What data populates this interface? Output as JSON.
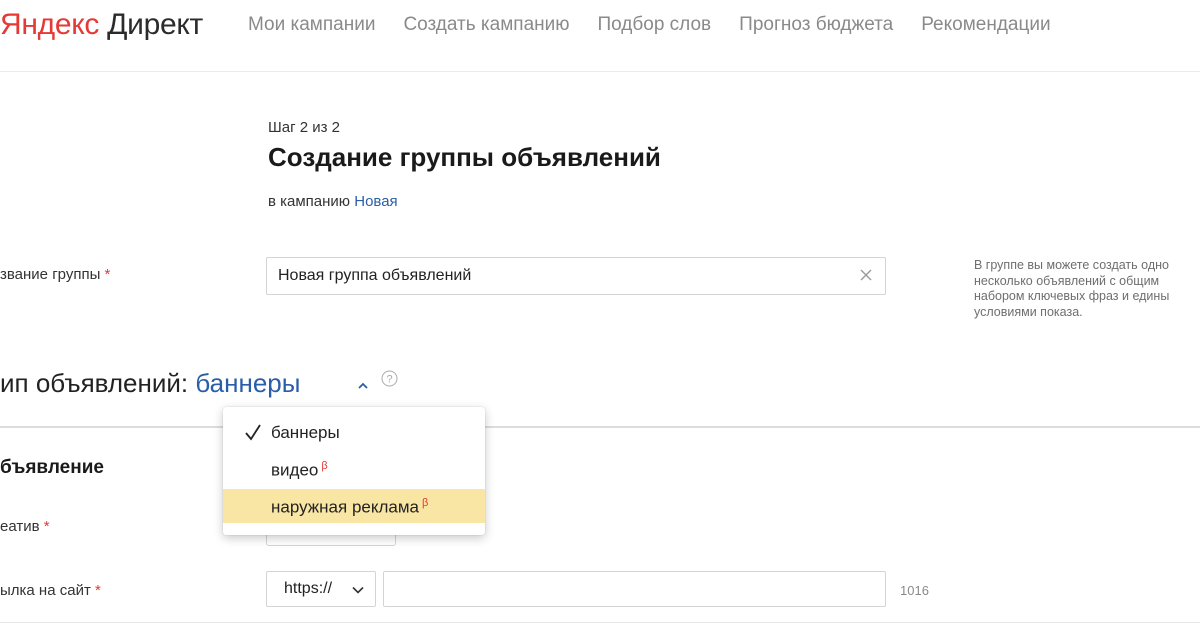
{
  "logo": {
    "part1": "Яндекс",
    "part2": "Директ"
  },
  "nav": {
    "items": [
      {
        "label": "Мои кампании"
      },
      {
        "label": "Создать кампанию"
      },
      {
        "label": "Подбор слов"
      },
      {
        "label": "Прогноз бюджета"
      },
      {
        "label": "Рекомендации"
      }
    ]
  },
  "step": "Шаг 2 из 2",
  "title": "Создание группы объявлений",
  "campaign": {
    "prefix": "в кампанию",
    "link": "Новая"
  },
  "group_name": {
    "label": "звание группы",
    "required": "*",
    "value": "Новая группа объявлений"
  },
  "hint": {
    "lines": [
      "В группе вы можете создать одно",
      "несколько объявлений с общим",
      "набором ключевых фраз и едины",
      "условиями показа."
    ]
  },
  "ad_type": {
    "prefix": "ип объявлений:",
    "value": "баннеры"
  },
  "dropdown": {
    "items": [
      {
        "label": "баннеры",
        "selected": true,
        "beta": ""
      },
      {
        "label": "видео",
        "selected": false,
        "beta": "β"
      },
      {
        "label": "наружная реклама",
        "selected": false,
        "beta": "β",
        "highlighted": true
      }
    ]
  },
  "ad_section": {
    "heading": "бъявление"
  },
  "creative": {
    "label": "еатив",
    "required": "*"
  },
  "url": {
    "label": "ылка на сайт",
    "required": "*",
    "protocol": "https://",
    "value": "",
    "char_count": "1016"
  },
  "colors": {
    "brand_red": "#e53935",
    "link_blue": "#2b5ea8",
    "highlight": "#f9e6a4"
  }
}
